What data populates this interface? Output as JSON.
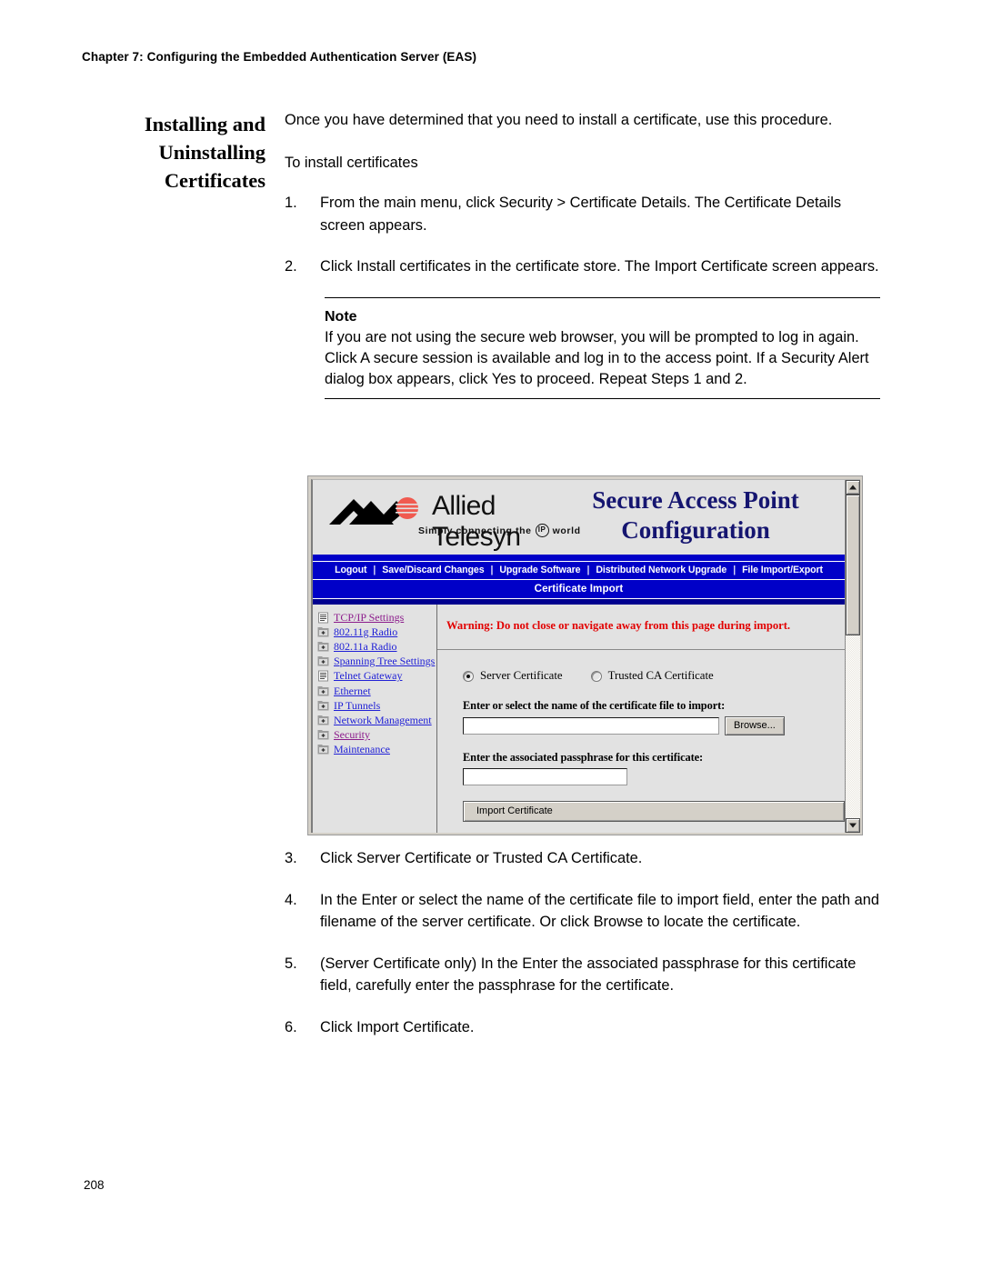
{
  "header": {
    "chapter": "Chapter 7: Configuring the Embedded Authentication Server (EAS)",
    "page_number": "208"
  },
  "section": {
    "heading_line1": "Installing and",
    "heading_line2": "Uninstalling",
    "heading_line3": "Certificates"
  },
  "body": {
    "intro": "Once you have determined that you need to install a certificate, use this procedure.",
    "subheading": "To install certificates",
    "steps_before": [
      {
        "num": "1.",
        "text": "From the main menu, click Security > Certificate Details. The Certificate Details screen appears."
      },
      {
        "num": "2.",
        "text": "Click Install certificates in the certificate store. The Import Certificate screen appears."
      }
    ],
    "steps_after": [
      {
        "num": "3.",
        "text": "Click Server Certificate or Trusted CA Certificate."
      },
      {
        "num": "4.",
        "text": "In the Enter or select the name of the certificate file to import field, enter the path and filename of the server certificate. Or click Browse to locate the certificate."
      },
      {
        "num": "5.",
        "text": "(Server Certificate only) In the Enter the associated passphrase for this certificate field, carefully enter the passphrase for the certificate."
      },
      {
        "num": "6.",
        "text": "Click Import Certificate."
      }
    ]
  },
  "note": {
    "title": "Note",
    "text": "If you are not using the secure web browser, you will be prompted to log in again. Click A secure session is available and log in to the access point. If a Security Alert dialog box appears, click Yes to proceed. Repeat Steps 1 and 2."
  },
  "screenshot": {
    "brand": {
      "name": "Allied Telesyn",
      "tagline_before": "Simply connecting the",
      "tagline_badge": "IP",
      "tagline_after": "world"
    },
    "banner_title_line1": "Secure Access Point",
    "banner_title_line2": "Configuration",
    "nav_items": [
      "Logout",
      "Save/Discard Changes",
      "Upgrade Software",
      "Distributed Network Upgrade",
      "File Import/Export"
    ],
    "nav_separator": "|",
    "page_title": "Certificate Import",
    "sidebar": [
      {
        "label": "TCP/IP Settings",
        "icon": "document-icon",
        "visited": true
      },
      {
        "label": "802.11g Radio",
        "icon": "folder-plus-icon",
        "visited": false
      },
      {
        "label": "802.11a Radio",
        "icon": "folder-plus-icon",
        "visited": false
      },
      {
        "label": "Spanning Tree Settings",
        "icon": "folder-plus-icon",
        "visited": false
      },
      {
        "label": "Telnet Gateway",
        "icon": "document-icon",
        "visited": false
      },
      {
        "label": "Ethernet",
        "icon": "folder-plus-icon",
        "visited": false
      },
      {
        "label": "IP Tunnels",
        "icon": "folder-plus-icon",
        "visited": false
      },
      {
        "label": "Network Management",
        "icon": "folder-plus-icon",
        "visited": false
      },
      {
        "label": "Security",
        "icon": "folder-plus-icon",
        "visited": true
      },
      {
        "label": "Maintenance",
        "icon": "folder-plus-icon",
        "visited": false
      }
    ],
    "warning": "Warning: Do not close or navigate away from this page during import.",
    "radio_server": "Server Certificate",
    "radio_trusted": "Trusted CA Certificate",
    "label_file": "Enter or select the name of the certificate file to import:",
    "value_file": "",
    "browse_button": "Browse...",
    "label_passphrase": "Enter the associated passphrase for this certificate:",
    "value_passphrase": "",
    "import_button": "Import Certificate",
    "colors": {
      "nav_blue": "#0000c8",
      "title_navy": "#151570",
      "warning_red": "#e20000",
      "link_blue": "#2121d6",
      "link_visited": "#8b1a8b",
      "logo_red": "#f05a50"
    }
  }
}
